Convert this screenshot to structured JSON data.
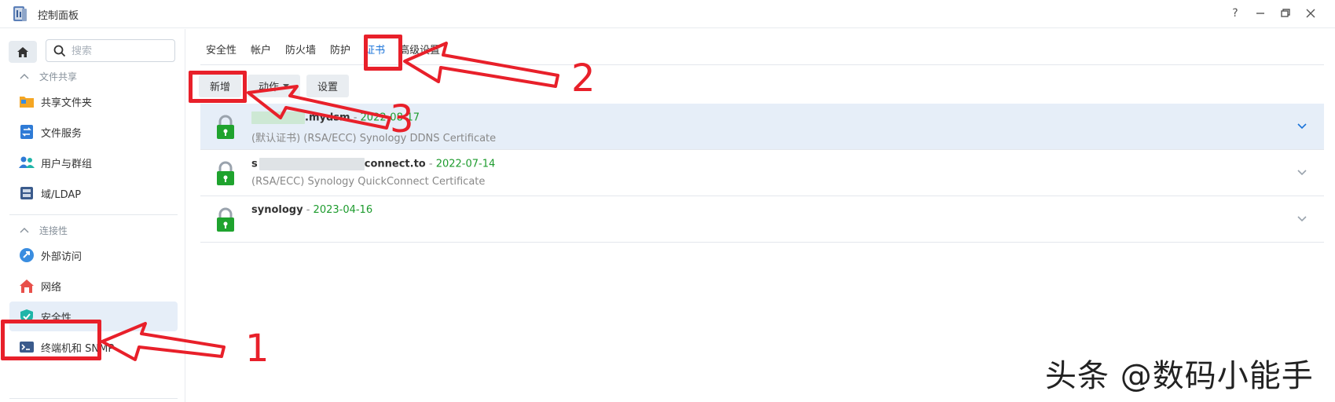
{
  "window": {
    "title": "控制面板",
    "buttons": {
      "help": "?",
      "minimize": "—",
      "restore": "🗗",
      "close": "✕"
    }
  },
  "sidebar": {
    "search_placeholder": "搜索",
    "sections": [
      {
        "title": "文件共享",
        "items": [
          {
            "label": "共享文件夹",
            "icon": "shared-folder-icon"
          },
          {
            "label": "文件服务",
            "icon": "file-services-icon"
          },
          {
            "label": "用户与群组",
            "icon": "users-groups-icon"
          },
          {
            "label": "域/LDAP",
            "icon": "domain-ldap-icon"
          }
        ]
      },
      {
        "title": "连接性",
        "items": [
          {
            "label": "外部访问",
            "icon": "external-access-icon"
          },
          {
            "label": "网络",
            "icon": "network-icon"
          },
          {
            "label": "安全性",
            "icon": "security-shield-icon",
            "active": true
          },
          {
            "label": "终端机和 SNMP",
            "icon": "terminal-icon"
          }
        ]
      }
    ]
  },
  "tabs": [
    "安全性",
    "帐户",
    "防火墙",
    "防护",
    "证书",
    "高级设置"
  ],
  "active_tab": "证书",
  "toolbar": {
    "new": "新增",
    "action": "动作",
    "settings": "设置"
  },
  "certificates": [
    {
      "name_suffix": ".mydsm",
      "sep": " - ",
      "date": "2022-08-17",
      "desc": "(默认证书) (RSA/ECC) Synology DDNS Certificate"
    },
    {
      "name_prefix": "s",
      "name_suffix": "connect.to",
      "sep": " - ",
      "date": "2022-07-14",
      "desc": "(RSA/ECC) Synology QuickConnect Certificate"
    },
    {
      "name": "synology",
      "sep": " - ",
      "date": "2023-04-16",
      "desc": ""
    }
  ],
  "annotations": {
    "n1": "1",
    "n2": "2",
    "n3": "3"
  },
  "watermark": "头条 @数码小能手",
  "colors": {
    "accent": "#1a73d9",
    "date_green": "#1d9b2d",
    "annotation_red": "#e8202a",
    "selected_bg": "#e6eef8"
  }
}
